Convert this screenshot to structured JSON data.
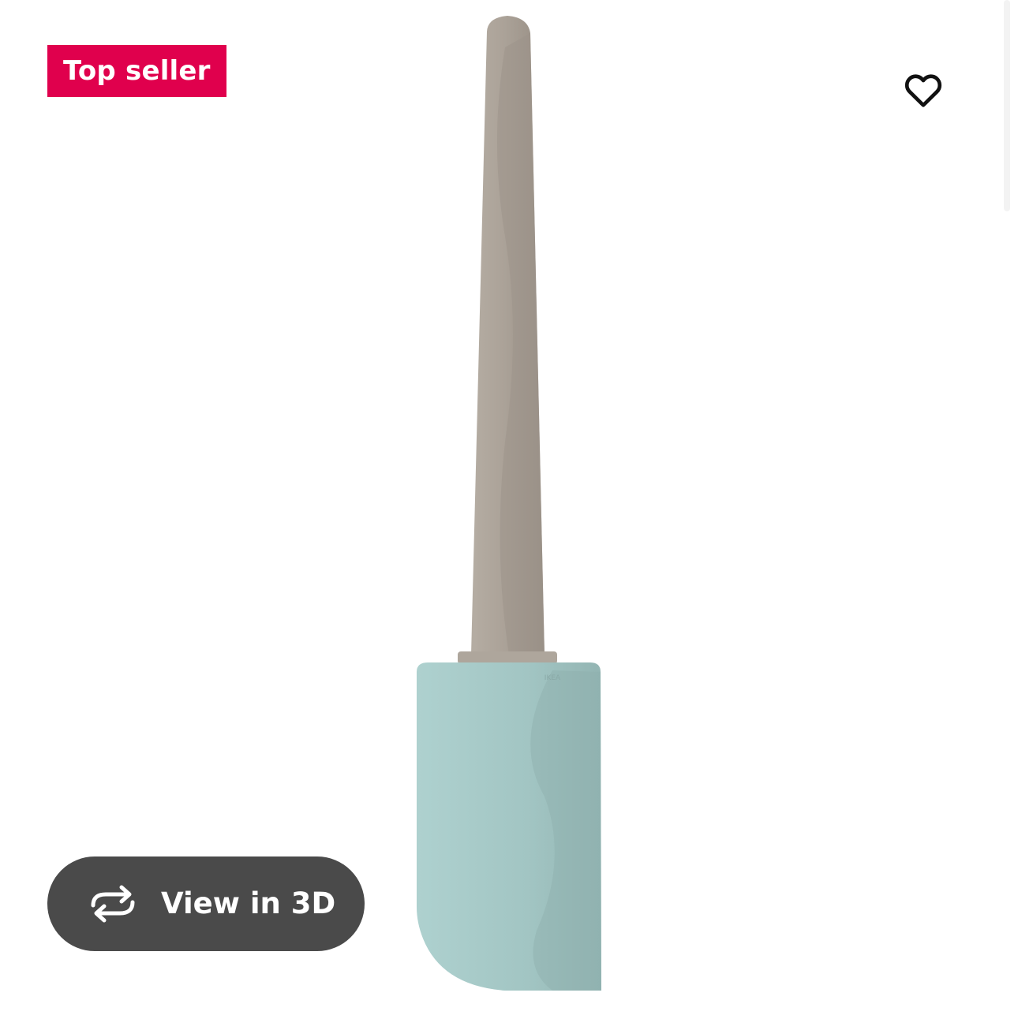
{
  "badge": {
    "label": "Top seller",
    "color": "#e0004d"
  },
  "favourite": {
    "icon": "heart-outline-icon",
    "state": "not-saved"
  },
  "product_image": {
    "handle_color": "#a89f94",
    "blade_color": "#a3c7c5"
  },
  "view3d": {
    "icon": "rotate-3d-icon",
    "label": "View in 3D",
    "background": "#4a4a4a"
  }
}
